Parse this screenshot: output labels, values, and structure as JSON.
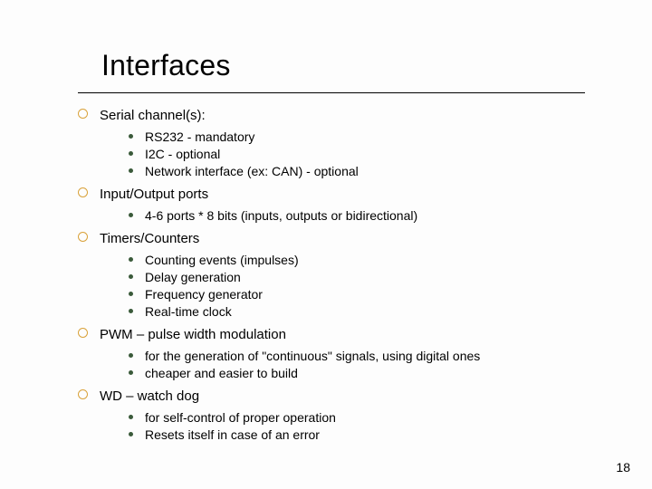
{
  "title": "Interfaces",
  "page_number": "18",
  "sections": [
    {
      "heading": "Serial channel(s):",
      "items": [
        "RS232 - mandatory",
        "I2C - optional",
        "Network interface (ex: CAN) - optional"
      ]
    },
    {
      "heading": "Input/Output ports",
      "items": [
        "4-6 ports * 8 bits (inputs, outputs or bidirectional)"
      ]
    },
    {
      "heading": "Timers/Counters",
      "items": [
        "Counting events (impulses)",
        "Delay generation",
        "Frequency generator",
        "Real-time clock"
      ]
    },
    {
      "heading": "PWM – pulse width modulation",
      "items": [
        "for the generation of \"continuous\" signals, using digital ones",
        "cheaper and easier to build"
      ]
    },
    {
      "heading": "WD – watch dog",
      "items": [
        "for self-control of proper operation",
        "Resets itself in case of an error"
      ]
    }
  ]
}
